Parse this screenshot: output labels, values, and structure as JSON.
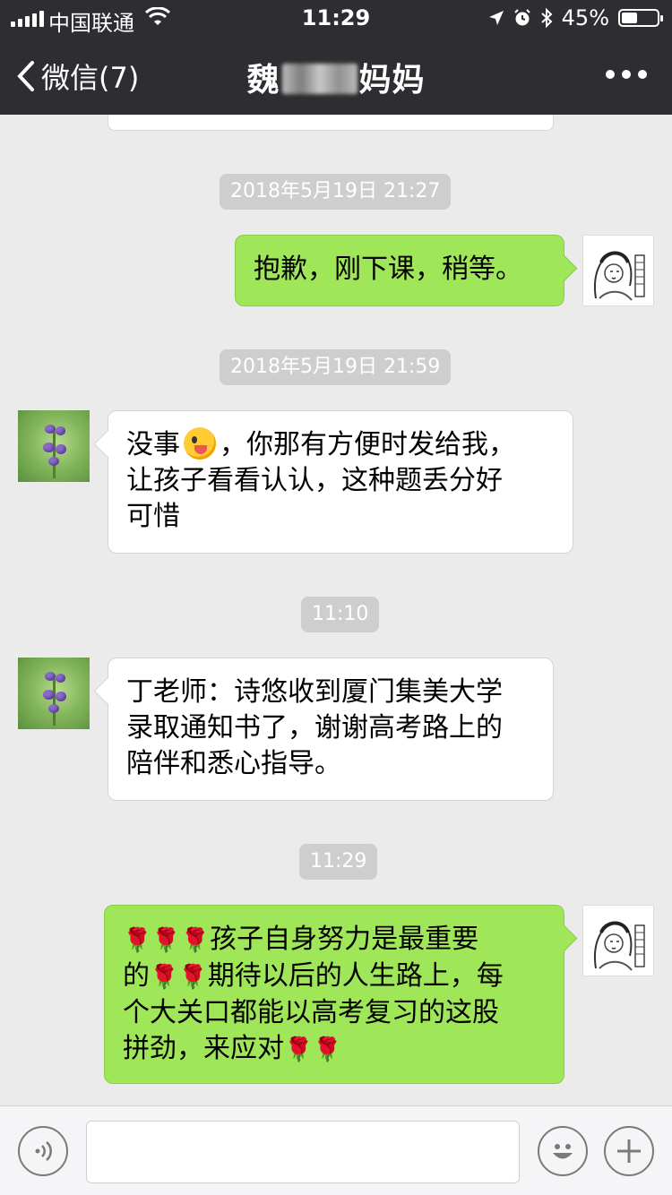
{
  "status_bar": {
    "carrier": "中国联通",
    "time": "11:29",
    "battery_text": "45%",
    "battery_level": 0.45
  },
  "nav": {
    "back_label": "微信(7)",
    "title_prefix": "魏",
    "title_suffix": "妈妈"
  },
  "messages": [
    {
      "type": "timestamp",
      "text": "2018年5月19日 21:27"
    },
    {
      "type": "sent",
      "text": "抱歉，刚下课，稍等。"
    },
    {
      "type": "timestamp",
      "text": "2018年5月19日 21:59"
    },
    {
      "type": "received",
      "text_a": "没事",
      "emoji": "winking-tongue-emoji",
      "text_b": "，你那有方便时发给我，",
      "text_c": "让孩子看看认认，这种题丢分好",
      "text_d": "可惜"
    },
    {
      "type": "timestamp",
      "text": "11:10"
    },
    {
      "type": "received",
      "line1": "丁老师：诗悠收到厦门集美大学",
      "line2": "录取通知书了，谢谢高考路上的",
      "line3": "陪伴和悉心指导。"
    },
    {
      "type": "timestamp",
      "text": "11:29"
    },
    {
      "type": "sent",
      "line1": "孩子自身努力是最重要",
      "line2a": "的",
      "line2b": "期待以后的人生路上，每",
      "line3": "个大关口都能以高考复习的这股",
      "line4": "拼劲，来应对",
      "rose": "🌹"
    }
  ],
  "input_bar": {
    "voice_icon": "voice-icon",
    "emoji_icon": "emoji-icon",
    "add_icon": "plus-icon"
  }
}
